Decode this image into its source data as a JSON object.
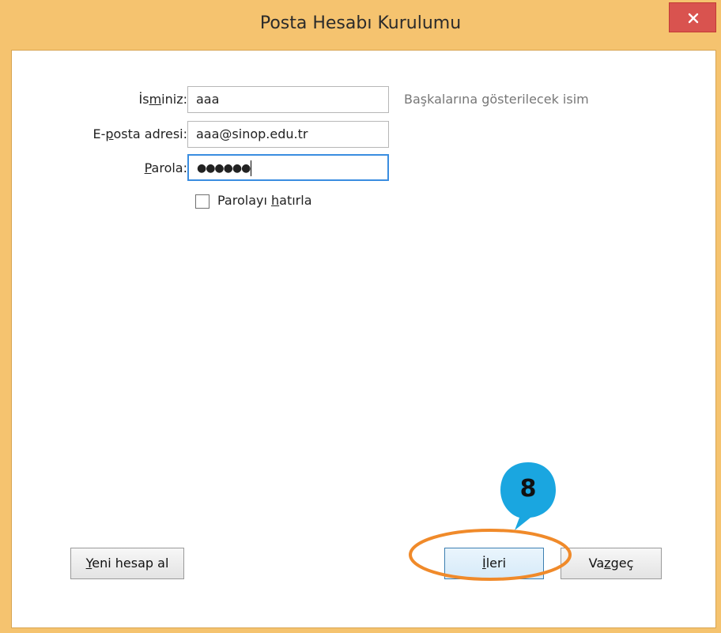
{
  "window": {
    "title": "Posta Hesabı Kurulumu"
  },
  "form": {
    "name": {
      "label_pre": "İ",
      "label_under": "s",
      "label_m": "m",
      "label_post": "iniz:",
      "value": "aaa",
      "hint": "Başkalarına gösterilecek isim"
    },
    "email": {
      "label_pre": "E-",
      "label_under": "p",
      "label_post": "osta adresi:",
      "value": "aaa@sinop.edu.tr"
    },
    "password": {
      "label_under": "P",
      "label_post": "arola:",
      "value": "●●●●●●"
    },
    "remember": {
      "label_pre": "Parolayı ",
      "label_under": "h",
      "label_post": "atırla",
      "checked": false
    }
  },
  "buttons": {
    "new_account": {
      "under": "Y",
      "rest": "eni hesap al"
    },
    "next": {
      "under": "İ",
      "rest": "leri"
    },
    "cancel": {
      "pre": "Va",
      "under": "z",
      "rest": "geç"
    }
  },
  "annotation": {
    "step_number": "8",
    "callout_color": "#1aa6e0",
    "highlight_color": "#f08a2a"
  }
}
